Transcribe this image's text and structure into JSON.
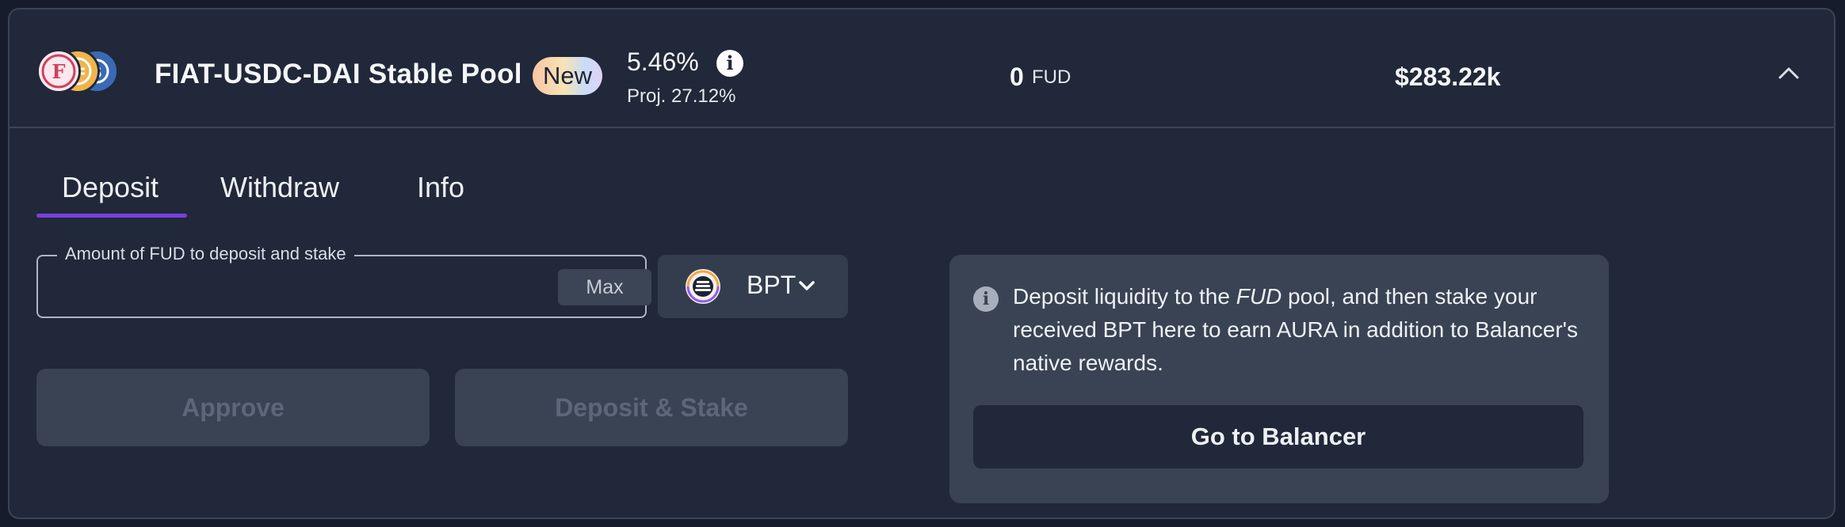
{
  "pool": {
    "name": "FIAT-USDC-DAI Stable Pool",
    "badge": "New",
    "apr": "5.46%",
    "projected": "Proj. 27.12%",
    "staked_amount": "0",
    "staked_unit": "FUD",
    "tvl": "$283.22k",
    "token_icons": [
      "fiat-token-icon",
      "usdc-token-icon",
      "dai-token-icon"
    ]
  },
  "tabs": [
    {
      "label": "Deposit",
      "active": true
    },
    {
      "label": "Withdraw",
      "active": false
    },
    {
      "label": "Info",
      "active": false
    }
  ],
  "deposit_form": {
    "field_label": "Amount of FUD to deposit and stake",
    "value": "",
    "placeholder": "",
    "max_label": "Max",
    "token": "BPT",
    "approve_label": "Approve",
    "deposit_label": "Deposit & Stake"
  },
  "info_panel": {
    "text_before": "Deposit liquidity to the ",
    "text_em": "FUD",
    "text_after": " pool, and then stake your received BPT here to earn AURA in addition to Balancer's native rewards.",
    "button_label": "Go to Balancer"
  },
  "colors": {
    "background": "#171c2c",
    "card": "#202839",
    "accent_tab": "#7a3fe0",
    "panel": "#394354",
    "disabled_button": "#3a4354"
  }
}
